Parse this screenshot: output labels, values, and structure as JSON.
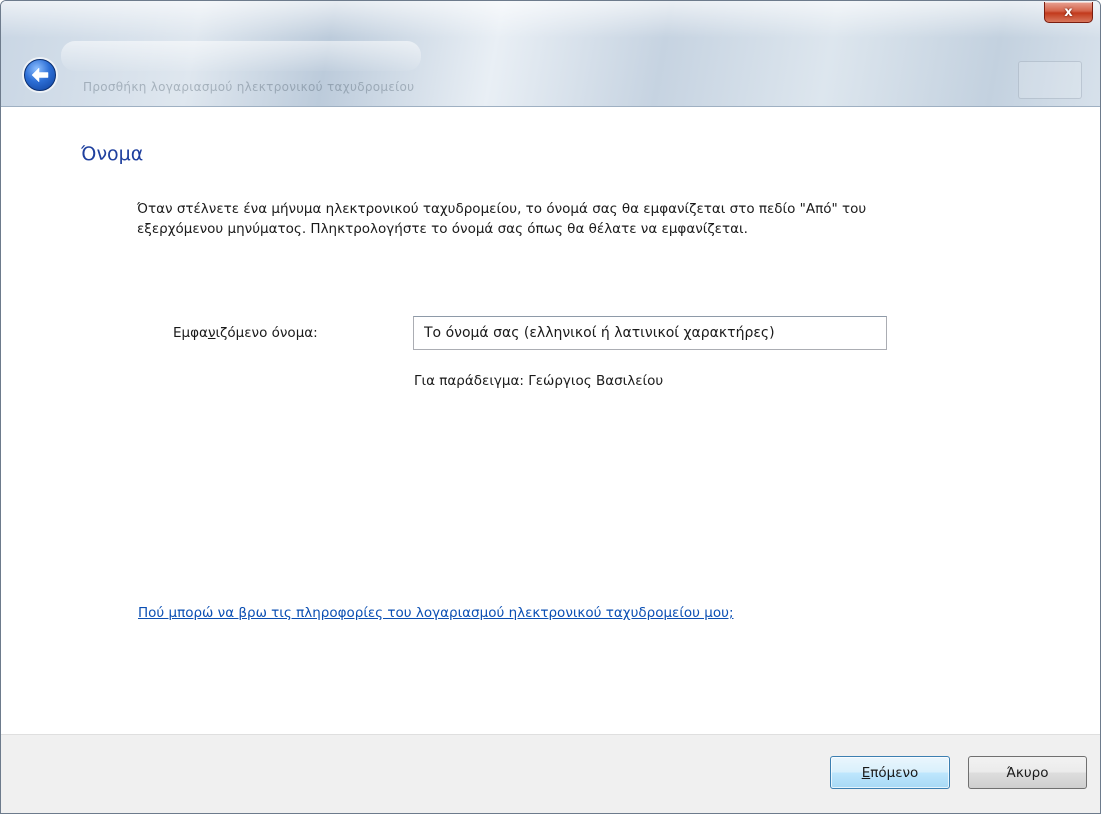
{
  "window": {
    "title": "Προσθήκη λογαριασμού ηλεκτρονικού ταχυδρομείου",
    "close_label": "x"
  },
  "icons": {
    "back": "back-arrow-icon",
    "close": "close-icon"
  },
  "page": {
    "heading": "Όνομα",
    "description": "Όταν στέλνετε ένα μήνυμα ηλεκτρονικού ταχυδρομείου, το όνομά σας θα εμφανίζεται στο πεδίο \"Από\" του εξερχόμενου μηνύματος. Πληκτρολογήστε το όνομά σας όπως θα θέλατε να εμφανίζεται.",
    "display_name_label_pre": "Εμφα",
    "display_name_label_access": "ν",
    "display_name_label_post": "ιζόμενο όνομα:",
    "display_name_value": "Το όνομά σας (ελληνικοί ή λατινικοί χαρακτήρες)",
    "example_text": "Για παράδειγμα: Γεώργιος Βασιλείου",
    "help_link": "Πού μπορώ να βρω τις πληροφορίες του λογαριασμού ηλεκτρονικού ταχυδρομείου μου;"
  },
  "footer": {
    "next_access": "Ε",
    "next_rest": "πόμενο",
    "cancel_label": "Άκυρο"
  },
  "colors": {
    "heading": "#1e3f9e",
    "link": "#0b4fb3",
    "footer_bg": "#f0f0f0",
    "close_red": "#c23a1c"
  }
}
